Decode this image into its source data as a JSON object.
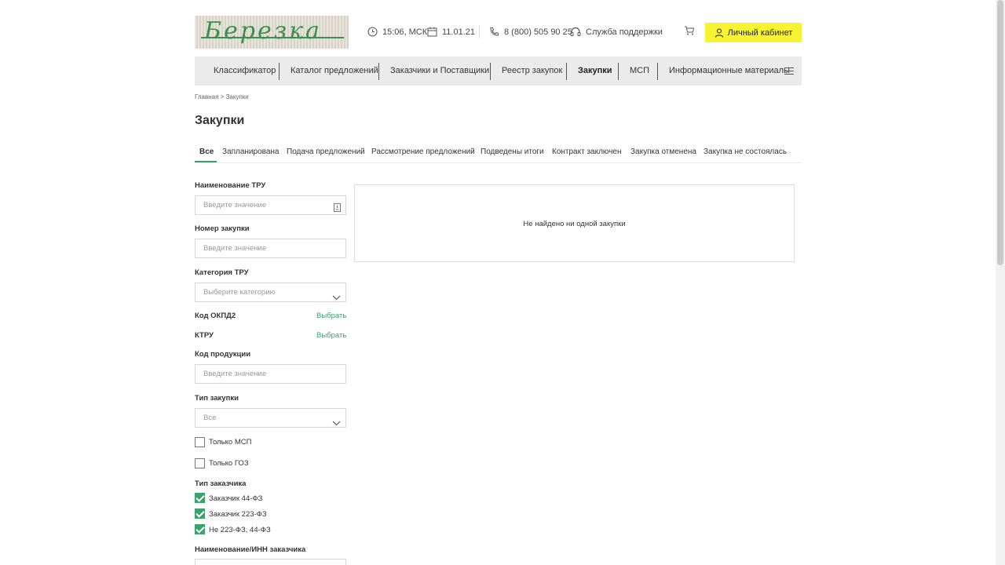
{
  "header": {
    "logo_text": "Березка",
    "time": "15:06, МСК",
    "date": "11.01.21",
    "phone": "8 (800) 505 90 25",
    "support": "Служба поддержки",
    "account_button": "Личный кабинет",
    "accent_color": "#f7f330"
  },
  "nav": {
    "items": [
      {
        "label": "Классификатор"
      },
      {
        "label": "Каталог предложений"
      },
      {
        "label": "Заказчики и Поставщики"
      },
      {
        "label": "Реестр закупок"
      },
      {
        "label": "Закупки"
      },
      {
        "label": "МСП"
      },
      {
        "label": "Информационные материалы"
      }
    ],
    "active": "Закупки"
  },
  "breadcrumb": "Главная > Закупки",
  "page_title": "Закупки",
  "tabs": [
    {
      "label": "Все"
    },
    {
      "label": "Запланирована"
    },
    {
      "label": "Подача предложений"
    },
    {
      "label": "Рассмотрение предложений"
    },
    {
      "label": "Подведены итоги"
    },
    {
      "label": "Контракт заключен"
    },
    {
      "label": "Закупка отменена"
    },
    {
      "label": "Закупка не состоялась"
    }
  ],
  "filters": {
    "tru_name": {
      "label": "Наименование ТРУ",
      "placeholder": "Введите значение"
    },
    "purchase_number": {
      "label": "Номер закупки",
      "placeholder": "Введите значение"
    },
    "tru_category": {
      "label": "Категория ТРУ",
      "placeholder": "Выберите категорию"
    },
    "okpd2": {
      "label": "Код ОКПД2",
      "link": "Выбрать"
    },
    "ktru": {
      "label": "КТРУ",
      "link": "Выбрать"
    },
    "product_code": {
      "label": "Код продукции",
      "placeholder": "Введите значение"
    },
    "purchase_type": {
      "label": "Тип закупки",
      "value": "Все"
    },
    "only_msp": {
      "label": "Только МСП",
      "checked": false
    },
    "only_goz": {
      "label": "Только ГОЗ",
      "checked": false
    },
    "customer_type": {
      "label": "Тип заказчика",
      "options": [
        {
          "label": "Заказчик 44-ФЗ",
          "checked": true
        },
        {
          "label": "Заказчик 223-ФЗ",
          "checked": true
        },
        {
          "label": "Не 223-ФЗ, 44-ФЗ",
          "checked": true
        }
      ]
    },
    "customer_name": {
      "label": "Наименование/ИНН заказчика"
    }
  },
  "results": {
    "empty_text": "Не найдено ни одной закупки"
  },
  "colors": {
    "green": "#3a9f6a",
    "nav_bg": "#ebebeb"
  }
}
